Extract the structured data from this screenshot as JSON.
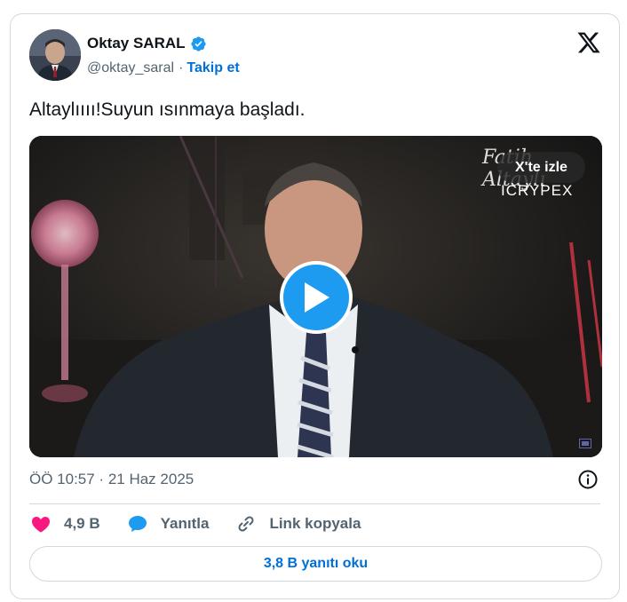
{
  "author": {
    "name": "Oktay SARAL",
    "handle": "@oktay_saral",
    "separator": "·",
    "follow_label": "Takip et"
  },
  "tweet": {
    "text": "Altaylıııı!Suyun ısınmaya başladı."
  },
  "media": {
    "watermark_script": "Fatih Altaylı",
    "watermark_brand": "ICRYPEX",
    "watch_on_x_label": "X'te izle"
  },
  "meta": {
    "timestamp": "ÖÖ 10:57 · 21 Haz 2025"
  },
  "actions": {
    "likes_count": "4,9 B",
    "reply_label": "Yanıtla",
    "copy_link_label": "Link kopyala"
  },
  "replies_button": {
    "label": "3,8 B yanıtı oku"
  },
  "colors": {
    "accent": "#1d9bf0",
    "link": "#006fd6",
    "like": "#f91880",
    "muted": "#536471",
    "border": "#cfd9de"
  },
  "icons": [
    "verified-badge-icon",
    "x-logo-icon",
    "play-icon",
    "info-icon",
    "heart-icon",
    "reply-bubble-icon",
    "link-icon"
  ]
}
